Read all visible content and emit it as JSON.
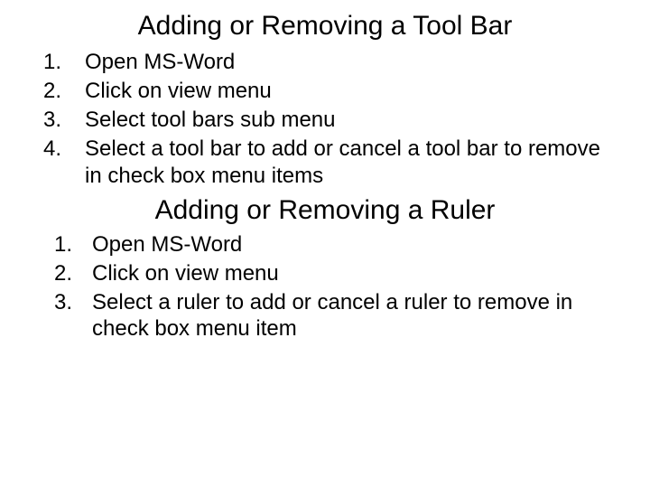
{
  "section1": {
    "title": "Adding or Removing a Tool Bar",
    "steps": [
      "Open MS-Word",
      "Click on view menu",
      "Select tool bars sub menu",
      "Select a tool bar to add or cancel a tool bar to remove in check box menu items"
    ]
  },
  "section2": {
    "title": "Adding or Removing a Ruler",
    "steps": [
      "Open MS-Word",
      "Click on view menu",
      "Select a ruler to add or cancel a ruler to remove in check box menu item"
    ]
  }
}
